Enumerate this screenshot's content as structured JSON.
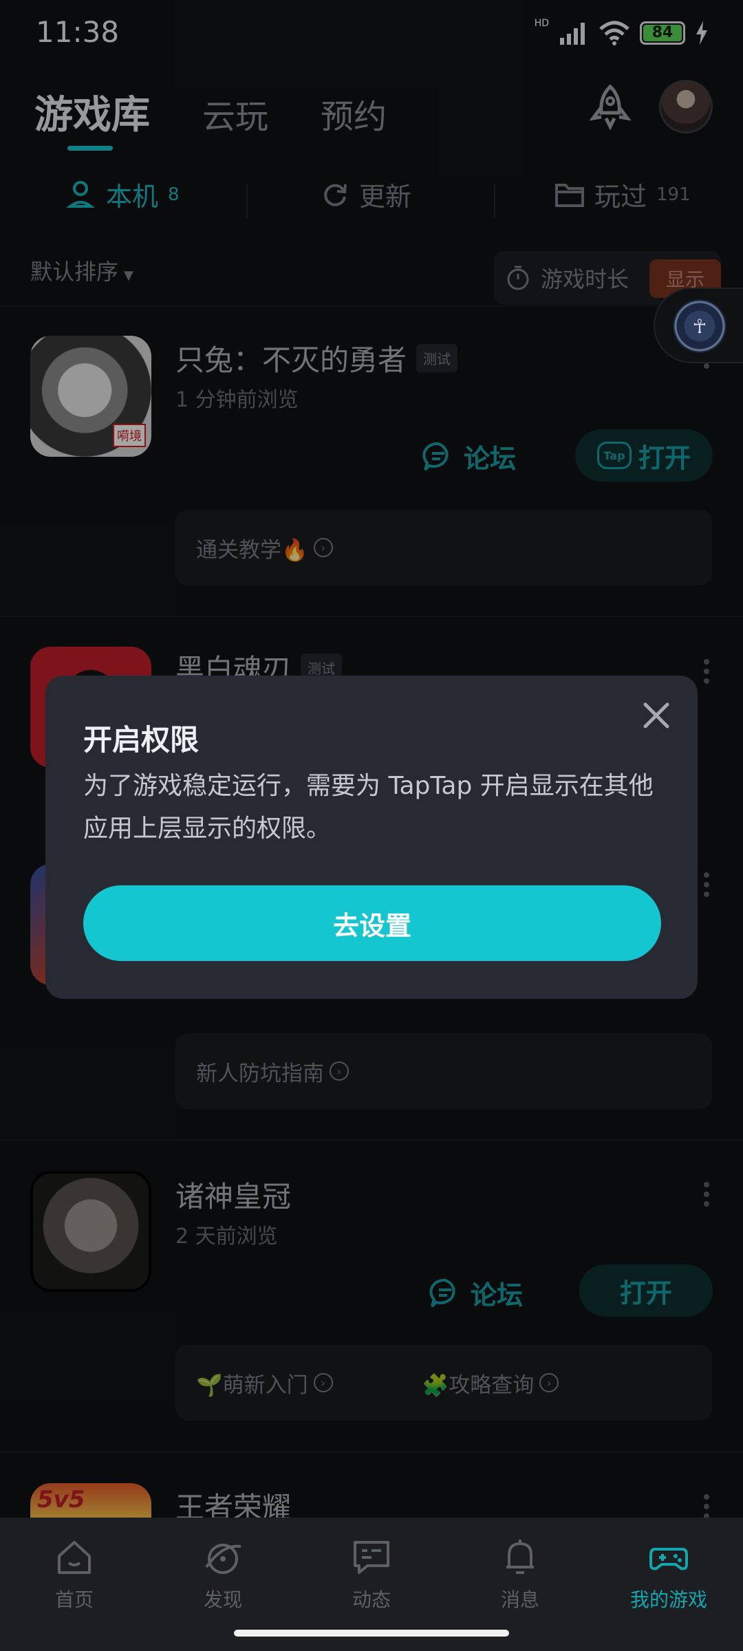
{
  "status_bar": {
    "time": "11:38",
    "network": "HD",
    "battery": "84"
  },
  "header": {
    "tabs": [
      {
        "label": "游戏库"
      },
      {
        "label": "云玩"
      },
      {
        "label": "预约"
      }
    ]
  },
  "sub_tabs": [
    {
      "label": "本机",
      "count": "8"
    },
    {
      "label": "更新",
      "count": ""
    },
    {
      "label": "玩过",
      "count": "191"
    }
  ],
  "sort": {
    "label": "默认排序",
    "playtime_label": "游戏时长",
    "show_label": "显示"
  },
  "games": [
    {
      "title": "只兔：不灭的勇者",
      "tag": "测试",
      "subtitle": "1 分钟前浏览",
      "forum_label": "论坛",
      "open_label": "打开",
      "open_logo": "Tap",
      "guides": [
        {
          "text": "通关教学🔥"
        }
      ]
    },
    {
      "title": "黑白魂刃",
      "tag": "测试"
    },
    {
      "guides": [
        {
          "text": "新人防坑指南"
        }
      ]
    },
    {
      "title": "诸神皇冠",
      "subtitle": "2 天前浏览",
      "forum_label": "论坛",
      "open_label": "打开",
      "guides": [
        {
          "text": "🌱萌新入门"
        },
        {
          "text": "🧩攻略查询"
        }
      ]
    },
    {
      "title": "王者荣耀",
      "icon_text": "5v5"
    }
  ],
  "dialog": {
    "title": "开启权限",
    "body": "为了游戏稳定运行，需要为 TapTap 开启显示在其他应用上层显示的权限。",
    "button": "去设置"
  },
  "bottom_nav": [
    {
      "label": "首页",
      "icon": "home-icon"
    },
    {
      "label": "发现",
      "icon": "discover-icon"
    },
    {
      "label": "动态",
      "icon": "chat-icon"
    },
    {
      "label": "消息",
      "icon": "bell-icon"
    },
    {
      "label": "我的游戏",
      "icon": "gamepad-icon",
      "active": true
    }
  ],
  "colors": {
    "accent": "#14c6cf",
    "background": "#101214",
    "dialog": "#272a33"
  }
}
